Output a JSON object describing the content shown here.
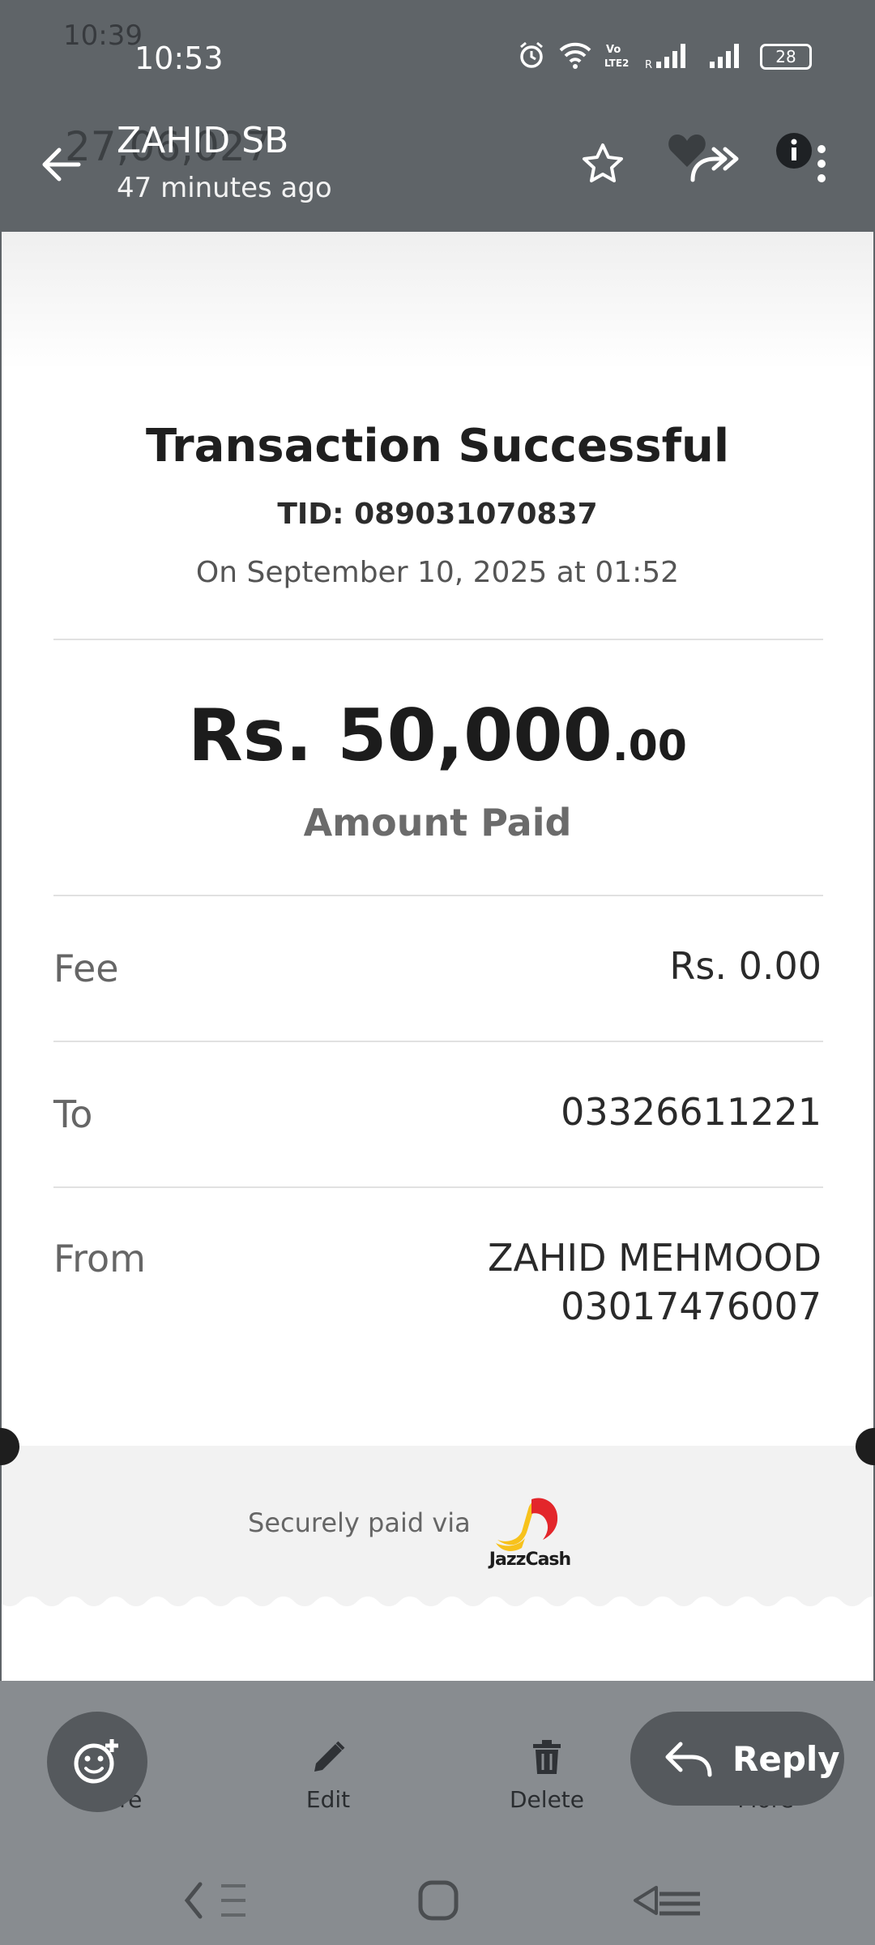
{
  "status_bar": {
    "ghost_time": "10:39",
    "time": "10:53",
    "battery": "28"
  },
  "app_bar": {
    "ghost_title": "27,06,027",
    "title": "ZAHID SB",
    "subtitle": "47 minutes ago"
  },
  "receipt": {
    "title": "Transaction Successful",
    "tid": "TID: 089031070837",
    "date": "On September 10, 2025 at 01:52",
    "amount_main": "Rs. 50,000",
    "amount_cents": ".00",
    "amount_label": "Amount Paid",
    "rows": [
      {
        "label": "Fee",
        "value": "Rs. 0.00"
      },
      {
        "label": "To",
        "value": "03326611221"
      },
      {
        "label": "From",
        "value_line1": "ZAHID MEHMOOD",
        "value_line2": "03017476007"
      }
    ],
    "secure_text": "Securely paid via",
    "brand_logo_text": "JazzCash"
  },
  "toolbar": {
    "share": "Share",
    "edit": "Edit",
    "delete": "Delete",
    "more": "More",
    "reply": "Reply"
  },
  "colors": {
    "status_bar_bg": "#5f6468",
    "receipt_bg": "#ffffff",
    "jazzcash_yellow": "#f7c21c",
    "jazzcash_red": "#e3262b",
    "battery_fill": "#d6a62a"
  },
  "icons": [
    "alarm-icon",
    "wifi-icon",
    "volte-icon",
    "signal-icon",
    "battery-icon",
    "back-arrow-icon",
    "star-icon",
    "heart-icon",
    "forward-icon",
    "info-icon",
    "more-vert-icon",
    "share-icon",
    "edit-icon",
    "delete-icon",
    "more-icon",
    "add-reaction-icon",
    "reply-icon",
    "nav-back-icon",
    "nav-home-icon",
    "nav-recents-icon"
  ]
}
